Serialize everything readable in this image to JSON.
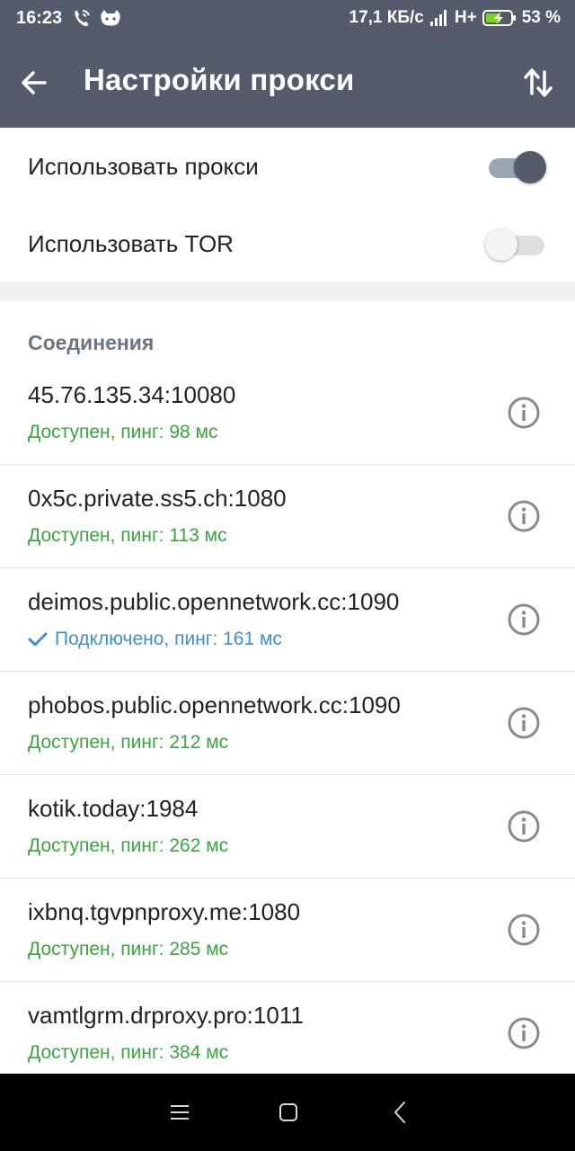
{
  "status_bar": {
    "time": "16:23",
    "speed": "17,1 КБ/с",
    "network": "H+",
    "battery": "53 %",
    "icons": [
      "phone-wifi-icon",
      "cat-icon",
      "signal-icon",
      "battery-charging-icon"
    ]
  },
  "toolbar": {
    "title": "Настройки прокси",
    "back_icon": "arrow-back-icon",
    "sort_icon": "sort-icon"
  },
  "toggles": {
    "use_proxy": {
      "label": "Использовать прокси",
      "on": true
    },
    "use_tor": {
      "label": "Использовать TOR",
      "on": false
    }
  },
  "connections": {
    "header": "Соединения",
    "items": [
      {
        "host": "45.76.135.34:10080",
        "status": "Доступен, пинг: 98 мс",
        "connected": false
      },
      {
        "host": "0x5c.private.ss5.ch:1080",
        "status": "Доступен, пинг: 113 мс",
        "connected": false
      },
      {
        "host": "deimos.public.opennetwork.cc:1090",
        "status": "Подключено, пинг: 161 мс",
        "connected": true
      },
      {
        "host": "phobos.public.opennetwork.cc:1090",
        "status": "Доступен, пинг: 212 мс",
        "connected": false
      },
      {
        "host": "kotik.today:1984",
        "status": "Доступен, пинг: 262 мс",
        "connected": false
      },
      {
        "host": "ixbnq.tgvpnproxy.me:1080",
        "status": "Доступен, пинг: 285 мс",
        "connected": false
      },
      {
        "host": "vamtlgrm.drproxy.pro:1011",
        "status": "Доступен, пинг: 384 мс",
        "connected": false
      }
    ]
  },
  "colors": {
    "toolbar": "#555b6a",
    "available": "#3aa53f",
    "connected": "#3f8ed0",
    "section_header": "#6b7680"
  },
  "navbar": {
    "icons": [
      "menu-icon",
      "home-icon",
      "back-icon"
    ]
  }
}
